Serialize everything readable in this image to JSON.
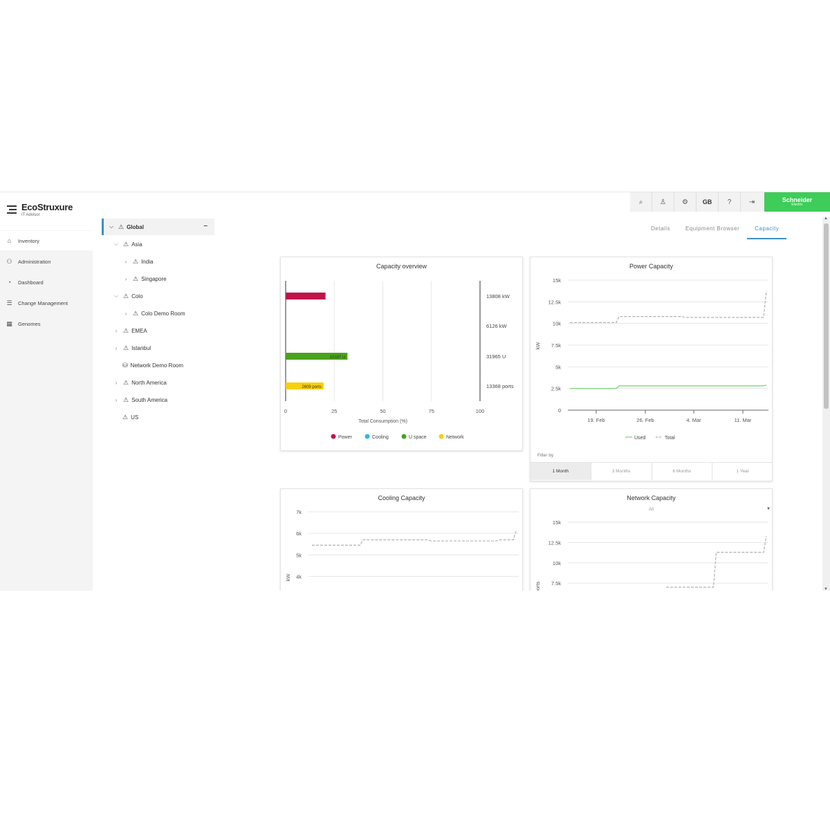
{
  "app": {
    "logo": "EcoStruxure",
    "logo_sub": "IT Advisor",
    "brand_name": "Schneider",
    "brand_sub": "Electric"
  },
  "nav": {
    "items": [
      {
        "label": "Inventory",
        "icon": "home-icon"
      },
      {
        "label": "Administration",
        "icon": "users-icon"
      },
      {
        "label": "Dashboard",
        "icon": "dashboard-icon"
      },
      {
        "label": "Change Management",
        "icon": "list-icon"
      },
      {
        "label": "Genomes",
        "icon": "genome-icon"
      }
    ]
  },
  "toolbar": {
    "locale": "GB",
    "icons": [
      "search-icon",
      "user-icon",
      "gear-icon",
      "help-icon",
      "logout-icon"
    ]
  },
  "tree": {
    "root": "Global",
    "items": [
      {
        "label": "Asia"
      },
      {
        "label": "India"
      },
      {
        "label": "Singapore"
      },
      {
        "label": "Colo"
      },
      {
        "label": "Colo Demo Room"
      },
      {
        "label": "EMEA"
      },
      {
        "label": "Istanbul"
      },
      {
        "label": "Network Demo Room"
      },
      {
        "label": "North America"
      },
      {
        "label": "South America"
      },
      {
        "label": "US"
      }
    ]
  },
  "tabs": [
    "Details",
    "Equipment Browser",
    "Capacity"
  ],
  "active_tab": "Capacity",
  "filter": {
    "label": "Filter by",
    "options": [
      "1 Month",
      "3 Months",
      "6 Months",
      "1 Year"
    ],
    "selected": "1 Month"
  },
  "colors": {
    "power": "#c0134a",
    "cooling": "#2fb8e8",
    "uspace": "#4aa31c",
    "network": "#f7cf0c",
    "accent": "#3d8fc6",
    "brand": "#3dcd58",
    "used": "#6cd46c",
    "total": "#b0b0b0"
  },
  "chart_data": [
    {
      "type": "bar",
      "title": "Capacity overview",
      "xlabel": "Total Consumption (%)",
      "xlim": [
        0,
        100
      ],
      "xticks": [
        "0",
        "25",
        "50",
        "75",
        "100"
      ],
      "categories": [
        "Power",
        "Cooling",
        "U space",
        "Network"
      ],
      "values": [
        20.5,
        0,
        31.8,
        19.5
      ],
      "bar_labels": [
        "",
        "",
        "10187 U",
        "2609 ports"
      ],
      "totals": [
        "13808 kW",
        "6126 kW",
        "31965 U",
        "13368 ports"
      ],
      "legend": [
        "Power",
        "Cooling",
        "U space",
        "Network"
      ]
    },
    {
      "type": "line",
      "title": "Power Capacity",
      "ylabel": "kW",
      "ylim": [
        0,
        15000
      ],
      "yticks": [
        "0",
        "2.5k",
        "5k",
        "7.5k",
        "10k",
        "12.5k",
        "15k"
      ],
      "xticks": [
        "19. Feb",
        "26. Feb",
        "4. Mar",
        "11. Mar"
      ],
      "legend": [
        "Used",
        "Total"
      ],
      "series": [
        {
          "name": "Used",
          "values": [
            2500,
            2500,
            2500,
            2800,
            2800,
            2800,
            2800,
            2800,
            2800,
            2800,
            2800,
            2800,
            2900
          ]
        },
        {
          "name": "Total",
          "values": [
            10100,
            10100,
            10100,
            10800,
            10800,
            10800,
            10800,
            10700,
            10700,
            10700,
            10700,
            10700,
            13800
          ]
        }
      ]
    },
    {
      "type": "line",
      "title": "Cooling Capacity",
      "ylabel": "kW",
      "ylim": [
        3500,
        7000
      ],
      "yticks": [
        "4k",
        "5k",
        "6k",
        "7k"
      ],
      "series": [
        {
          "name": "Total",
          "values": [
            5450,
            5450,
            5450,
            5700,
            5700,
            5700,
            5700,
            5650,
            5650,
            5650,
            5650,
            5700,
            6100
          ]
        }
      ]
    },
    {
      "type": "line",
      "title": "Network Capacity",
      "subtitle": "All",
      "ylabel": "ports",
      "ylim": [
        7000,
        15000
      ],
      "yticks": [
        "7.5k",
        "10k",
        "12.5k",
        "15k"
      ],
      "series": [
        {
          "name": "Total",
          "values": [
            7000,
            7000,
            7000,
            7000,
            7000,
            7000,
            11300,
            11300,
            11300,
            11300,
            11300,
            11300,
            13300
          ]
        }
      ]
    }
  ]
}
